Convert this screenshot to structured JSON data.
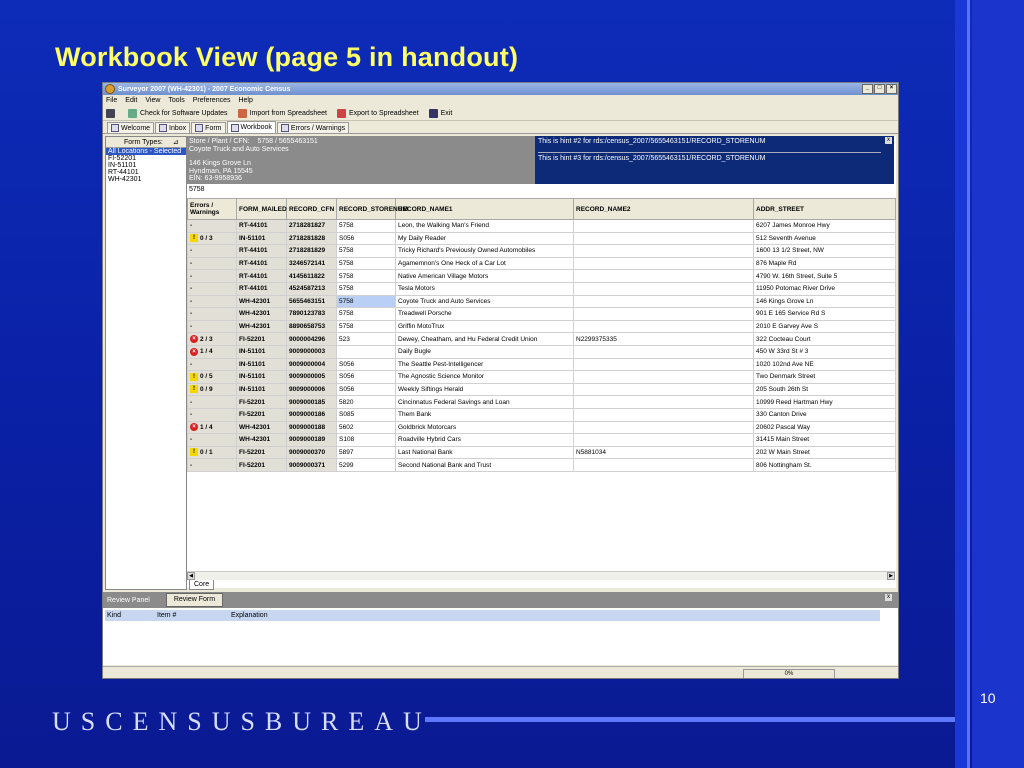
{
  "slide": {
    "title": "Workbook View (page 5 in handout)",
    "footer_brand": "USCENSUSBUREAU",
    "slide_number": "10"
  },
  "window": {
    "title": "Surveyor 2007 (WH-42301) - 2007 Economic Census",
    "menu": [
      "File",
      "Edit",
      "View",
      "Tools",
      "Preferences",
      "Help"
    ],
    "toolbar": {
      "check_updates": "Check for Software Updates",
      "import": "Import from Spreadsheet",
      "export": "Export to Spreadsheet",
      "exit": "Exit"
    },
    "tabs": [
      "Welcome",
      "Inbox",
      "Form",
      "Workbook",
      "Errors / Warnings"
    ]
  },
  "left_panel": {
    "header": "Form Types:",
    "items": [
      "All Locations - Selected It",
      "FI-52201",
      "IN-51101",
      "RT-44101",
      "WH-42301"
    ]
  },
  "header_info": {
    "line1_label": "Store / Plant / CFN:",
    "line1_value": "5758 / 5655463151",
    "line2": "Coyote Truck and Auto Services",
    "line3": "146 Kings Grove Ln",
    "line4": "Hyndman, PA 15545",
    "line5": "EIN: 63-9958936",
    "hint2": "This is hint #2 for rds:/census_2007/5655463151/RECORD_STORENUM",
    "hint3": "This is hint #3 for rds:/census_2007/5655463151/RECORD_STORENUM"
  },
  "current_value": "5758",
  "table": {
    "columns": [
      "Errors / Warnings",
      "FORM_MAILED",
      "RECORD_CFN",
      "RECORD_STORENUM",
      "RECORD_NAME1",
      "RECORD_NAME2",
      "ADDR_STREET"
    ],
    "rows": [
      {
        "ew": "-",
        "type": "",
        "form": "RT-44101",
        "cfn": "2718281827",
        "store": "5758",
        "name1": "Leon, the Walking Man's Friend",
        "name2": "",
        "street": "6207 James Monroe Hwy"
      },
      {
        "ew": "0 / 3",
        "type": "warn",
        "form": "IN-51101",
        "cfn": "2718281828",
        "store": "S056",
        "name1": "My Daily Reader",
        "name2": "",
        "street": "512 Seventh Avenue"
      },
      {
        "ew": "-",
        "type": "",
        "form": "RT-44101",
        "cfn": "2718281829",
        "store": "5758",
        "name1": "Tricky Richard's Previously Owned Automobiles",
        "name2": "",
        "street": "1600 13 1/2 Street, NW"
      },
      {
        "ew": "-",
        "type": "",
        "form": "RT-44101",
        "cfn": "3246572141",
        "store": "5758",
        "name1": "Agamemnon's One Heck of a Car Lot",
        "name2": "",
        "street": "876 Maple Rd"
      },
      {
        "ew": "-",
        "type": "",
        "form": "RT-44101",
        "cfn": "4145611822",
        "store": "5758",
        "name1": "Native American Village Motors",
        "name2": "",
        "street": "4790 W. 16th Street, Suite 5"
      },
      {
        "ew": "-",
        "type": "",
        "form": "RT-44101",
        "cfn": "4524587213",
        "store": "5758",
        "name1": "Tesla Motors",
        "name2": "",
        "street": "11950 Potomac River Drive"
      },
      {
        "ew": "-",
        "type": "",
        "form": "WH-42301",
        "cfn": "5655463151",
        "store": "5758",
        "name1": "Coyote Truck and Auto Services",
        "name2": "",
        "street": "146 Kings Grove Ln",
        "selected": true
      },
      {
        "ew": "-",
        "type": "",
        "form": "WH-42301",
        "cfn": "7890123783",
        "store": "5758",
        "name1": "Treadwell Porsche",
        "name2": "",
        "street": "901 E 165 Service Rd S"
      },
      {
        "ew": "-",
        "type": "",
        "form": "WH-42301",
        "cfn": "8890658753",
        "store": "5758",
        "name1": "Griffin MotoTrux",
        "name2": "",
        "street": "2010 E Garvey Ave S"
      },
      {
        "ew": "2 / 3",
        "type": "err",
        "form": "FI-52201",
        "cfn": "9000004296",
        "store": "523",
        "name1": "Dewey, Cheatham, and Hu Federal Credit Union",
        "name2": "N2299375335",
        "street": "322 Cocteau Court"
      },
      {
        "ew": "1 / 4",
        "type": "err",
        "form": "IN-51101",
        "cfn": "9009000003",
        "store": "",
        "name1": "Daily Bugle",
        "name2": "",
        "street": "450 W 33rd St # 3"
      },
      {
        "ew": "-",
        "type": "",
        "form": "IN-51101",
        "cfn": "9009000004",
        "store": "S056",
        "name1": "The Seattle Pest-Intelligencer",
        "name2": "",
        "street": "1020 102nd Ave NE"
      },
      {
        "ew": "0 / 5",
        "type": "warn",
        "form": "IN-51101",
        "cfn": "9009000005",
        "store": "S056",
        "name1": "The Agnostic Science Monitor",
        "name2": "",
        "street": "Two Denmark Street"
      },
      {
        "ew": "0 / 9",
        "type": "warn",
        "form": "IN-51101",
        "cfn": "9009000006",
        "store": "S056",
        "name1": "Weekly Siftings Herald",
        "name2": "",
        "street": "205 South 26th St"
      },
      {
        "ew": "-",
        "type": "",
        "form": "FI-52201",
        "cfn": "9009000185",
        "store": "5820",
        "name1": "Cincinnatus Federal Savings and Loan",
        "name2": "",
        "street": "10999 Reed Hartman Hwy"
      },
      {
        "ew": "-",
        "type": "",
        "form": "FI-52201",
        "cfn": "9009000186",
        "store": "S085",
        "name1": "Them Bank",
        "name2": "",
        "street": "330 Canton Drive"
      },
      {
        "ew": "1 / 4",
        "type": "err",
        "form": "WH-42301",
        "cfn": "9009000188",
        "store": "5602",
        "name1": "Goldbrick Motorcars",
        "name2": "",
        "street": "20602 Pascal Way"
      },
      {
        "ew": "-",
        "type": "",
        "form": "WH-42301",
        "cfn": "9009000189",
        "store": "S108",
        "name1": "Roadville Hybrid Cars",
        "name2": "",
        "street": "31415 Main Street"
      },
      {
        "ew": "0 / 1",
        "type": "warn",
        "form": "FI-52201",
        "cfn": "9009000370",
        "store": "5897",
        "name1": "Last National Bank",
        "name2": "N5881034",
        "street": "202 W Main Street"
      },
      {
        "ew": "-",
        "type": "",
        "form": "FI-52201",
        "cfn": "9009000371",
        "store": "5299",
        "name1": "Second National Bank and Trust",
        "name2": "",
        "street": "806 Nottingham St."
      }
    ]
  },
  "sheet_tab": "Core",
  "review": {
    "panel_label": "Review Panel",
    "tab_label": "Review Form",
    "columns": [
      "Kind",
      "Item #",
      "Explanation"
    ]
  },
  "status": {
    "progress": "0%"
  }
}
